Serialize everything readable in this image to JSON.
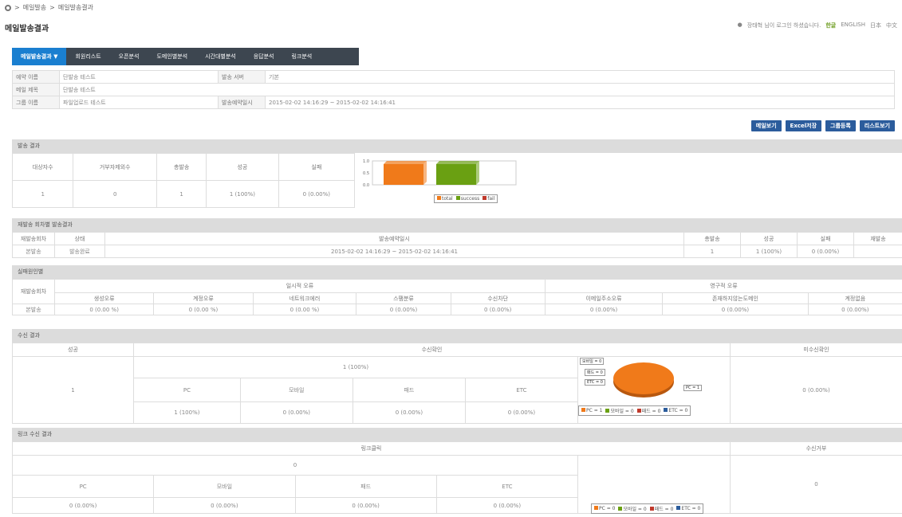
{
  "breadcrumb": {
    "a": "메일발송",
    "b": "메일발송결과"
  },
  "page_title": "메일발송결과",
  "topbar": {
    "welcome": "장태혁 님이 로그인 하셨습니다.",
    "lang_ko": "한글",
    "lang_en": "ENGLISH",
    "lang_ja": "日本",
    "lang_zh": "中文"
  },
  "tabs": [
    "메일발송결과 ▼",
    "회원리스트",
    "오픈분석",
    "도메인별분석",
    "시간대별분석",
    "응답분석",
    "링크분석"
  ],
  "info": {
    "r1_lab": "예약 이름",
    "r1_val": "단발송 테스트",
    "r1b_lab": "발송 서버",
    "r1b_val": "기본",
    "r2_lab": "메일 제목",
    "r2_val": "단발송 테스트",
    "r3_lab": "그룹 이름",
    "r3_val": "파일업로드 테스트",
    "r3b_lab": "발송예약일시",
    "r3b_val": "2015-02-02 14:16:29 ~ 2015-02-02 14:16:41"
  },
  "buttons": {
    "view_mail": "메일보기",
    "excel": "Excel저장",
    "group": "그룹등록",
    "list": "리스트보기"
  },
  "sec1": {
    "title": "발송 결과",
    "headers": [
      "대상자수",
      "거부자제외수",
      "총발송",
      "성공",
      "실패"
    ],
    "values": [
      "1",
      "0",
      "1",
      "1 (100%)",
      "0 (0.00%)"
    ],
    "legend": [
      "total",
      "success",
      "fail"
    ]
  },
  "chart_data": {
    "type": "bar",
    "categories": [
      "total",
      "success",
      "fail"
    ],
    "values": [
      1,
      1,
      0
    ],
    "colors": [
      "#f07a1a",
      "#6aa012",
      "#c0392b"
    ],
    "yticks": [
      "1.0",
      "0.5",
      "0.0"
    ],
    "ylim": [
      0,
      1
    ]
  },
  "sec2": {
    "title": "재발송 회차별 발송결과",
    "headers": [
      "재발송회차",
      "상태",
      "발송예약일시",
      "총발송",
      "성공",
      "실패",
      "재발송"
    ],
    "values": [
      "본발송",
      "발송완료",
      "2015-02-02 14:16:29 ~ 2015-02-02 14:16:41",
      "1",
      "1 (100%)",
      "0 (0.00%)",
      ""
    ]
  },
  "sec3": {
    "title": "실패원인별",
    "col0": "재발송회차",
    "temp_err": "일시적 오류",
    "perm_err": "영구적 오류",
    "headers": [
      "생성오류",
      "계정오류",
      "네트워크에러",
      "스팸분류",
      "수신차단",
      "이메일주소오류",
      "존재하지않는도메인",
      "계정없음"
    ],
    "row_label": "본발송",
    "values": [
      "0 (0.00 %)",
      "0 (0.00 %)",
      "0 (0.00 %)",
      "0 (0.00%)",
      "0 (0.00%)",
      "0 (0.00%)",
      "0 (0.00%)",
      "0 (0.00%)"
    ]
  },
  "sec4": {
    "title": "수신 결과",
    "success": "성공",
    "confirm": "수신확인",
    "unconfirm": "미수신확인",
    "success_val": "1",
    "confirm_total": "1 (100%)",
    "devices": [
      "PC",
      "모바일",
      "패드",
      "ETC"
    ],
    "device_vals": [
      "1 (100%)",
      "0 (0.00%)",
      "0 (0.00%)",
      "0 (0.00%)"
    ],
    "unconfirm_val": "0 (0.00%)",
    "pie_labels": [
      "모바일 = 0",
      "패드 = 0",
      "ETC = 0",
      "PC = 1"
    ],
    "legend": [
      "PC = 1",
      "모바일 = 0",
      "패드 = 0",
      "ETC = 0"
    ]
  },
  "sec5": {
    "title": "링크 수신 결과",
    "click": "링크클릭",
    "reject": "수신거부",
    "click_total": "0",
    "devices": [
      "PC",
      "모바일",
      "패드",
      "ETC"
    ],
    "device_vals": [
      "0 (0.00%)",
      "0 (0.00%)",
      "0 (0.00%)",
      "0 (0.00%)"
    ],
    "reject_val": "0",
    "legend": [
      "PC = 0",
      "모바일 = 0",
      "패드 = 0",
      "ETC = 0"
    ]
  },
  "colors": {
    "pc": "#f07a1a",
    "mobile": "#6aa012",
    "pad": "#c0392b",
    "etc": "#2b5c9c"
  }
}
